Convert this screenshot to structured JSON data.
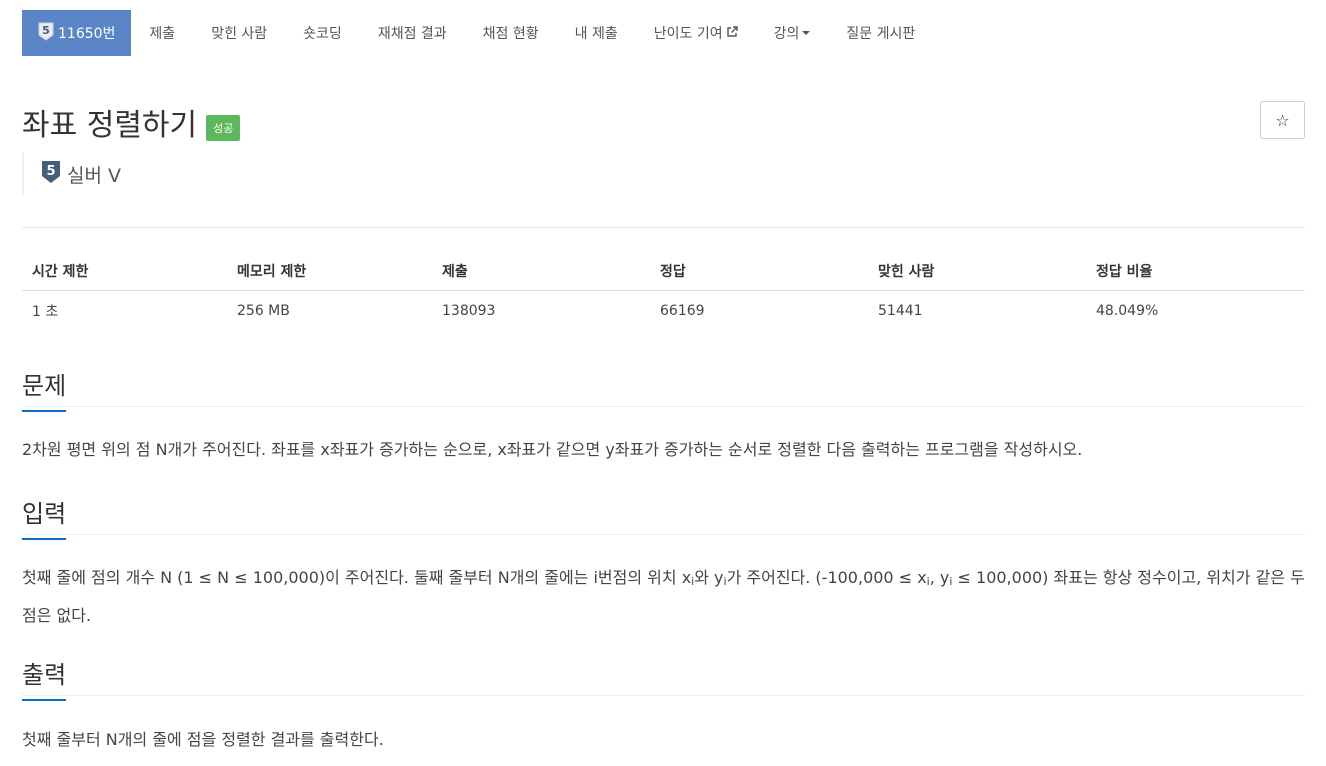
{
  "nav": {
    "problem_number": "11650번",
    "tier_badge": "5",
    "items": [
      "제출",
      "맞힌 사람",
      "숏코딩",
      "재채점 결과",
      "채점 현황",
      "내 제출",
      "난이도 기여",
      "강의",
      "질문 게시판"
    ]
  },
  "problem": {
    "title": "좌표 정렬하기",
    "status_badge": "성공",
    "tier_number": "5",
    "tier_name": "실버 V",
    "star_icon": "☆"
  },
  "info": {
    "headers": [
      "시간 제한",
      "메모리 제한",
      "제출",
      "정답",
      "맞힌 사람",
      "정답 비율"
    ],
    "values": [
      "1 초",
      "256 MB",
      "138093",
      "66169",
      "51441",
      "48.049%"
    ]
  },
  "sections": {
    "problem": {
      "heading": "문제",
      "text": "2차원 평면 위의 점 N개가 주어진다. 좌표를 x좌표가 증가하는 순으로, x좌표가 같으면 y좌표가 증가하는 순서로 정렬한 다음 출력하는 프로그램을 작성하시오."
    },
    "input": {
      "heading": "입력",
      "text_a": "첫째 줄에 점의 개수 N (1 ≤ N ≤ 100,000)이 주어진다. 둘째 줄부터 N개의 줄에는 i번점의 위치 x",
      "sub_i": "i",
      "text_b": "와 y",
      "text_c": "가 주어진다. (-100,000 ≤ x",
      "text_d": ", y",
      "text_e": " ≤ 100,000) 좌표는 항상 정수이고, 위치가 같은 두 점은 없다."
    },
    "output": {
      "heading": "출력",
      "text": "첫째 줄부터 N개의 줄에 점을 정렬한 결과를 출력한다."
    }
  },
  "colors": {
    "nav_active": "#5a85c7",
    "success": "#5cb85c",
    "section_underline": "#0a6ec7",
    "tier_silver": "#435f7a"
  }
}
